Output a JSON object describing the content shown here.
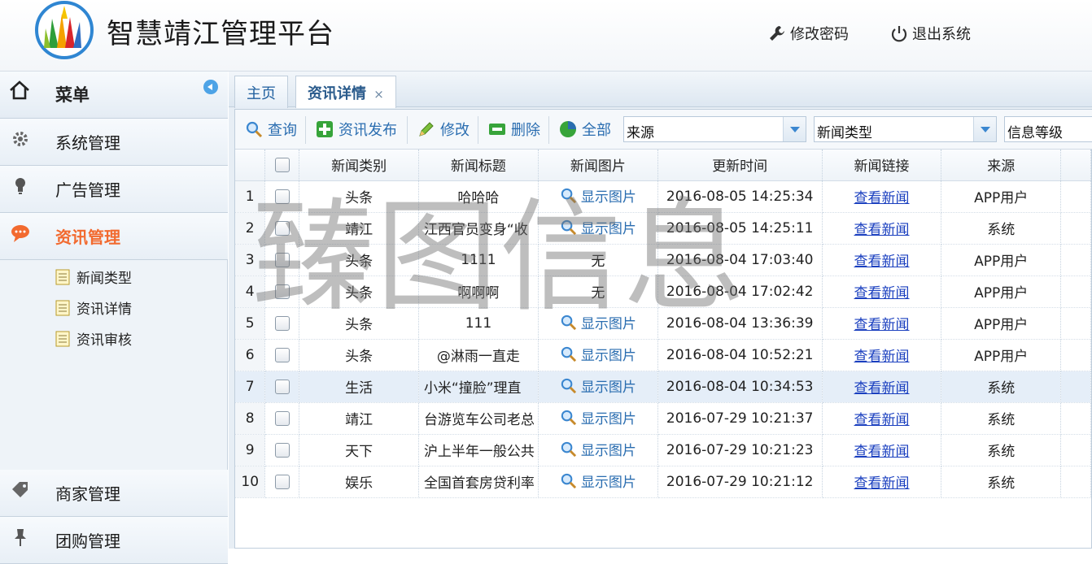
{
  "app": {
    "title": "智慧靖江管理平台"
  },
  "header": {
    "change_password": "修改密码",
    "logout": "退出系统"
  },
  "sidebar": {
    "menu_label": "菜单",
    "items": [
      {
        "label": "系统管理",
        "icon": "gear-icon"
      },
      {
        "label": "广告管理",
        "icon": "bulb-icon"
      },
      {
        "label": "资讯管理",
        "icon": "chat-bubble-icon"
      },
      {
        "label": "商家管理",
        "icon": "tag-icon"
      },
      {
        "label": "团购管理",
        "icon": "pin-icon"
      }
    ],
    "subitems": [
      "新闻类型",
      "资讯详情",
      "资讯审核"
    ]
  },
  "tabs": [
    {
      "label": "主页"
    },
    {
      "label": "资讯详情",
      "close": "×"
    }
  ],
  "toolbar": {
    "query": "查询",
    "publish": "资讯发布",
    "edit": "修改",
    "delete": "删除",
    "all": "全部",
    "source_select": "来源",
    "type_select": "新闻类型",
    "level_select": "信息等级"
  },
  "table": {
    "columns": [
      "新闻类别",
      "新闻标题",
      "新闻图片",
      "更新时间",
      "新闻链接",
      "来源"
    ],
    "show_image": "显示图片",
    "view_news": "查看新闻",
    "rows": [
      {
        "n": "1",
        "cat": "头条",
        "title": "哈哈哈",
        "img": true,
        "time": "2016-08-05 14:25:34",
        "src": "APP用户"
      },
      {
        "n": "2",
        "cat": "靖江",
        "title": "江西官员变身“收",
        "img": true,
        "time": "2016-08-05 14:25:11",
        "src": "系统"
      },
      {
        "n": "3",
        "cat": "头条",
        "title": "1111",
        "img": false,
        "img_text": "无",
        "time": "2016-08-04 17:03:40",
        "src": "APP用户"
      },
      {
        "n": "4",
        "cat": "头条",
        "title": "啊啊啊",
        "img": false,
        "img_text": "无",
        "time": "2016-08-04 17:02:42",
        "src": "APP用户"
      },
      {
        "n": "5",
        "cat": "头条",
        "title": "111",
        "img": true,
        "time": "2016-08-04 13:36:39",
        "src": "APP用户"
      },
      {
        "n": "6",
        "cat": "头条",
        "title": "@淋雨一直走",
        "img": true,
        "time": "2016-08-04 10:52:21",
        "src": "APP用户"
      },
      {
        "n": "7",
        "cat": "生活",
        "title": "小米“撞脸”理直",
        "img": true,
        "time": "2016-08-04 10:34:53",
        "src": "系统"
      },
      {
        "n": "8",
        "cat": "靖江",
        "title": "台游览车公司老总",
        "img": true,
        "time": "2016-07-29 10:21:37",
        "src": "系统"
      },
      {
        "n": "9",
        "cat": "天下",
        "title": "沪上半年一般公共",
        "img": true,
        "time": "2016-07-29 10:21:23",
        "src": "系统"
      },
      {
        "n": "10",
        "cat": "娱乐",
        "title": "全国首套房贷利率",
        "img": true,
        "time": "2016-07-29 10:21:12",
        "src": "系统"
      }
    ]
  },
  "watermark": "臻图信息"
}
